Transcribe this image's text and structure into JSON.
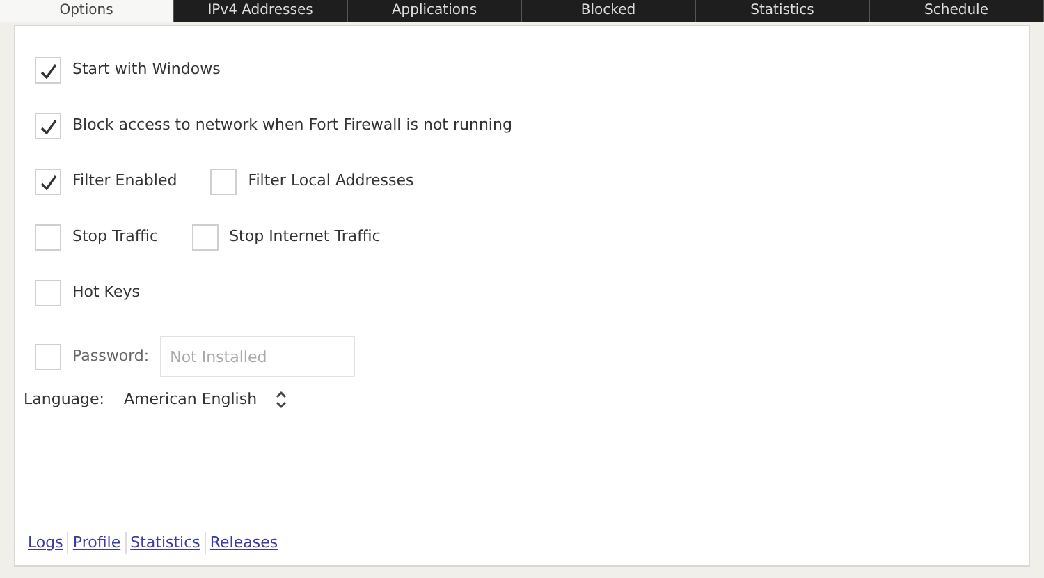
{
  "tabs": [
    {
      "label": "Options",
      "selected": true
    },
    {
      "label": "IPv4 Addresses",
      "selected": false
    },
    {
      "label": "Applications",
      "selected": false
    },
    {
      "label": "Blocked",
      "selected": false
    },
    {
      "label": "Statistics",
      "selected": false
    },
    {
      "label": "Schedule",
      "selected": false
    }
  ],
  "rows": [
    [
      {
        "label": "Start with Windows",
        "checked": true
      }
    ],
    [
      {
        "label": "Block access to network when Fort Firewall is not running",
        "checked": true
      }
    ],
    [
      {
        "label": "Filter Enabled",
        "checked": true
      },
      {
        "label": "Filter Local Addresses",
        "checked": false
      }
    ],
    [
      {
        "label": "Stop Traffic",
        "checked": false
      },
      {
        "label": "Stop Internet Traffic",
        "checked": false
      }
    ],
    [
      {
        "label": "Hot Keys",
        "checked": false
      }
    ]
  ],
  "password": {
    "label": "Password:",
    "checked": false,
    "placeholder": "Not Installed"
  },
  "language": {
    "label": "Language:",
    "value": "American English"
  },
  "links": [
    "Logs",
    "Profile",
    "Statistics",
    "Releases"
  ]
}
